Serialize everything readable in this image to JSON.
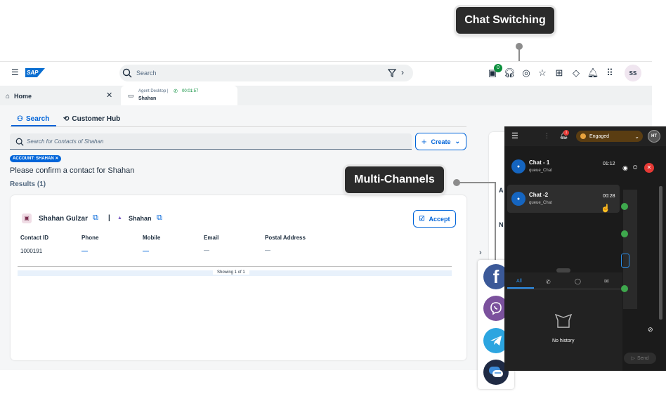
{
  "callouts": {
    "chat_switching": "Chat Switching",
    "multi_channels": "Multi-Channels"
  },
  "shell": {
    "logo": "SAP",
    "search_placeholder": "Search",
    "notification_badge": "0",
    "avatar": "SS"
  },
  "tabs": {
    "home": "Home",
    "agent_desktop": "Agent Desktop |",
    "timer": "00:01:57",
    "customer": "Shahan"
  },
  "subtabs": {
    "search": "Search",
    "customer_hub": "Customer Hub"
  },
  "search": {
    "placeholder": "Search for Contacts of Shahan",
    "create": "Create"
  },
  "account_token": "ACCOUNT: SHAHAN",
  "confirm_text": "Please confirm a contact for Shahan",
  "results": "Results (1)",
  "contact": {
    "name": "Shahan Gulzar",
    "account": "Shahan",
    "accept": "Accept",
    "headers": [
      "Contact ID",
      "Phone",
      "Mobile",
      "Email",
      "Postal Address"
    ],
    "values": [
      "1000191",
      "—",
      "—",
      "—",
      "—"
    ],
    "showing": "Showing 1 of 1"
  },
  "side_labels": {
    "a": "A",
    "n": "N"
  },
  "panel": {
    "notif_count": "1",
    "status": "Engaged",
    "avatar": "HT",
    "chats": [
      {
        "name": "Chat - 1",
        "queue": "queue_Chat",
        "time": "01:12"
      },
      {
        "name": "Chat -2",
        "queue": "queue_Chat",
        "time": "00:28"
      }
    ],
    "history_tabs": [
      "All"
    ],
    "no_history": "No history",
    "send": "Send"
  },
  "colors": {
    "accent": "#0064d9",
    "dark_panel": "#1b1b1b",
    "engaged": "#e8a33d",
    "facebook": "#3b5998",
    "viber": "#7b519d",
    "telegram": "#2ca5e0"
  }
}
